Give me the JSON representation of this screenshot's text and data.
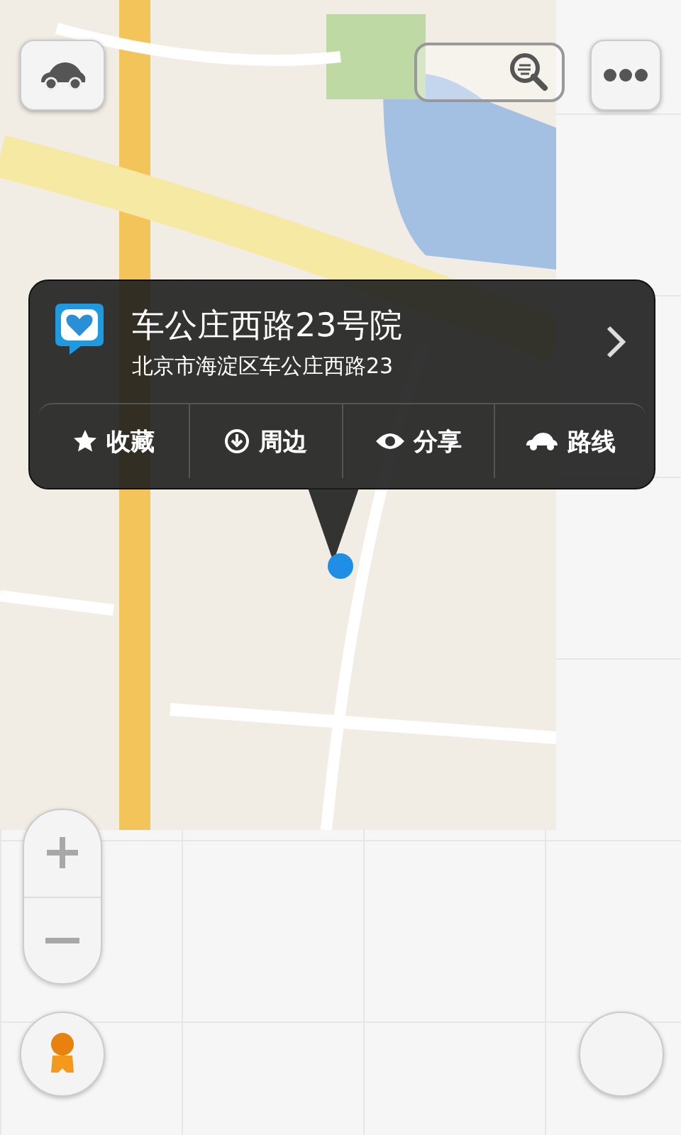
{
  "place_popup": {
    "title": "车公庄西路23号院",
    "address": "北京市海淀区车公庄西路23"
  },
  "actions": [
    {
      "kind": "star",
      "label": "收藏"
    },
    {
      "kind": "nearby",
      "label": "周边"
    },
    {
      "kind": "eye",
      "label": "分享"
    },
    {
      "kind": "car",
      "label": "路线"
    }
  ]
}
